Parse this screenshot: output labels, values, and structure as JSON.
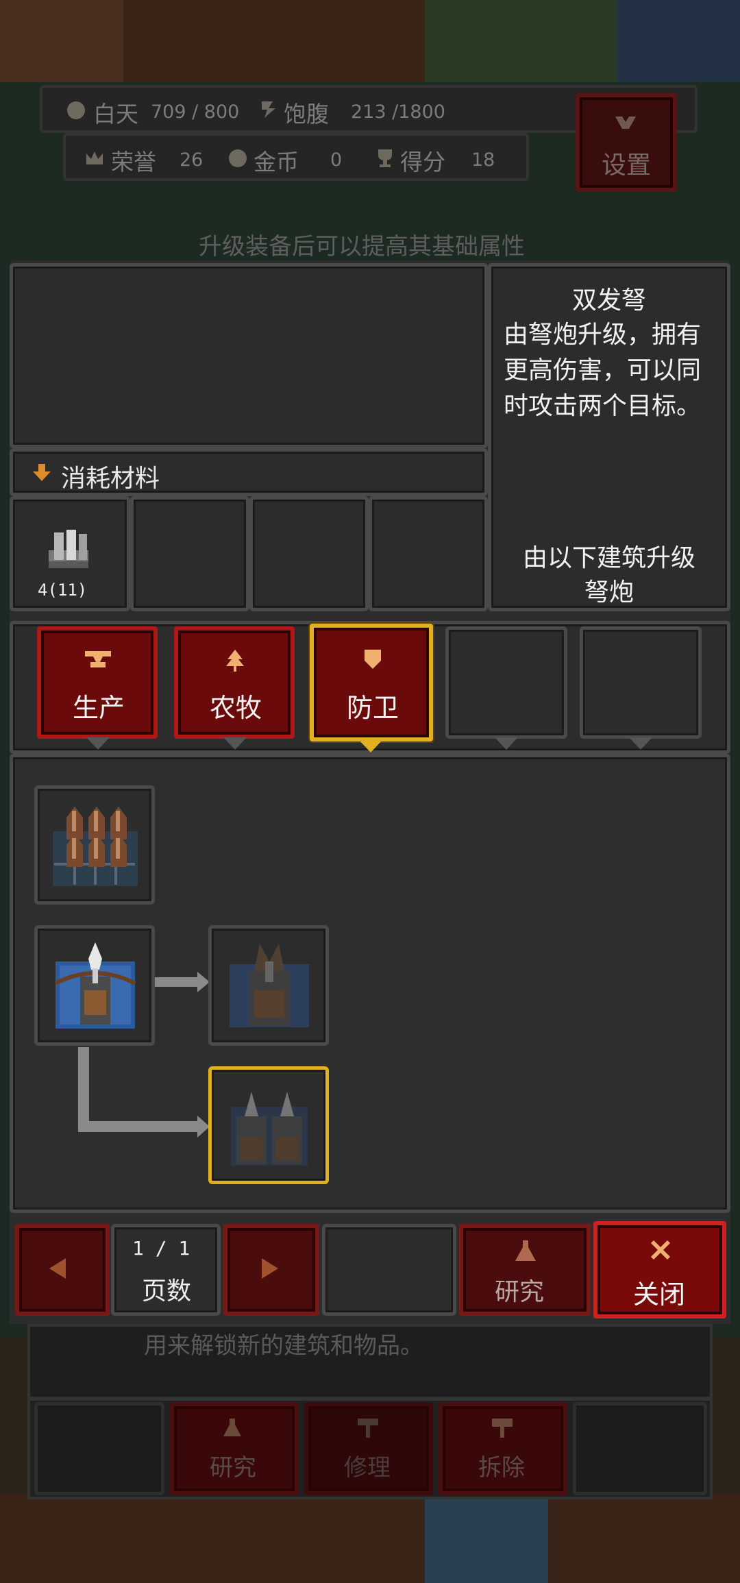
{
  "hud": {
    "day_label": "白天",
    "day_value": "709 / 800",
    "hunger_label": "饱腹",
    "hunger_value": "213 /1800",
    "honor_label": "荣誉",
    "honor_value": "26",
    "gold_label": "金币",
    "gold_value": "0",
    "score_label": "得分",
    "score_value": "18",
    "settings_label": "设置"
  },
  "hint_text": "升级装备后可以提高其基础属性",
  "materials": {
    "header": "消耗材料",
    "items": [
      {
        "icon": "iron-bar-icon",
        "count": "4(11)"
      }
    ]
  },
  "info": {
    "name": "双发弩",
    "description": "由弩炮升级，拥有更高伤害，可以同时攻击两个目标。",
    "desc_lines": [
      "由弩炮升级，拥有",
      "更高伤害，可以同",
      "时攻击两个目标。"
    ],
    "upgrade_from_label": "由以下建筑升级",
    "upgrade_from_value": "弩炮"
  },
  "tabs": [
    {
      "label": "生产",
      "icon": "anvil-icon",
      "active": false
    },
    {
      "label": "农牧",
      "icon": "tree-icon",
      "active": false
    },
    {
      "label": "防卫",
      "icon": "shield-icon",
      "active": true
    },
    {
      "label": "",
      "icon": "",
      "active": false
    },
    {
      "label": "",
      "icon": "",
      "active": false
    }
  ],
  "tree": {
    "nodes": [
      {
        "icon": "spike-trap-icon",
        "state": "unlocked"
      },
      {
        "icon": "ballista-icon",
        "state": "unlocked"
      },
      {
        "icon": "heavy-ballista-icon",
        "state": "locked"
      },
      {
        "icon": "twin-crossbow-icon",
        "state": "selected"
      }
    ]
  },
  "footer": {
    "page_value": "1 / 1",
    "page_label": "页数",
    "research_label": "研究",
    "close_label": "关闭"
  },
  "background": {
    "desc_text": "用来解锁新的建筑和物品。",
    "btn_research": "研究",
    "btn_repair": "修理",
    "btn_demolish": "拆除"
  },
  "colors": {
    "accent_red": "#b01818",
    "accent_gold": "#e0b020",
    "panel_bg": "#2a2a2a"
  }
}
